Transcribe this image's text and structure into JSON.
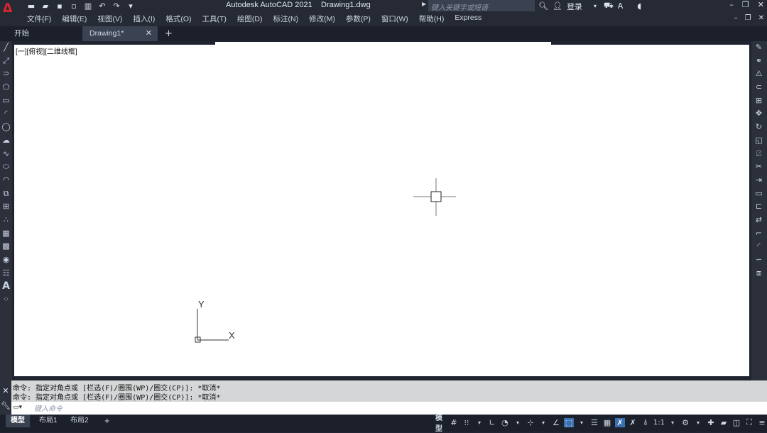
{
  "title_bar": {
    "app_title": "Autodesk AutoCAD 2021",
    "file_name": "Drawing1.dwg",
    "search_placeholder": "键入关键字或短语",
    "login_label": "登录",
    "qat_icons": [
      "new-icon",
      "open-icon",
      "save-icon",
      "saveas-icon",
      "plot-icon",
      "undo-icon",
      "redo-icon",
      "dropdown-icon"
    ]
  },
  "menu": [
    "文件(F)",
    "编辑(E)",
    "视图(V)",
    "插入(I)",
    "格式(O)",
    "工具(T)",
    "绘图(D)",
    "标注(N)",
    "修改(M)",
    "参数(P)",
    "窗口(W)",
    "帮助(H)",
    "Express"
  ],
  "tabs": {
    "start": "开始",
    "drawing": "Drawing1*"
  },
  "viewport_label": "[一][俯视][二维线框]",
  "ucs": {
    "x_label": "X",
    "y_label": "Y"
  },
  "command": {
    "history": [
      "命令: 指定对角点或 [栏选(F)/圈围(WP)/圈交(CP)]: *取消*",
      "命令: 指定对角点或 [栏选(F)/圈围(WP)/圈交(CP)]: *取消*"
    ],
    "input_placeholder": "键入命令"
  },
  "status": {
    "layout_tabs": [
      "模型",
      "布局1",
      "布局2"
    ],
    "model_label": "模型",
    "scale_label": "1:1"
  },
  "left_toolbar_icons": [
    "line-icon",
    "polyline-icon",
    "arc-icon",
    "polygon-icon",
    "rectangle-icon",
    "arc-icon",
    "circle-icon",
    "revcloud-icon",
    "spline-icon",
    "ellipse-icon",
    "ellipse-arc-icon",
    "insert-block-icon",
    "make-block-icon",
    "point-icon",
    "hatch-icon",
    "gradient-icon",
    "region-icon",
    "table-icon",
    "mtext-icon",
    "add-selected-icon"
  ],
  "right_toolbar_icons": [
    "erase-icon",
    "copy-icon",
    "mirror-icon",
    "offset-icon",
    "array-icon",
    "move-icon",
    "rotate-icon",
    "scale-icon",
    "stretch-icon",
    "trim-icon",
    "extend-icon",
    "break-point-icon",
    "break-icon",
    "join-icon",
    "chamfer-icon",
    "fillet-icon",
    "blend-icon",
    "explode-icon"
  ]
}
